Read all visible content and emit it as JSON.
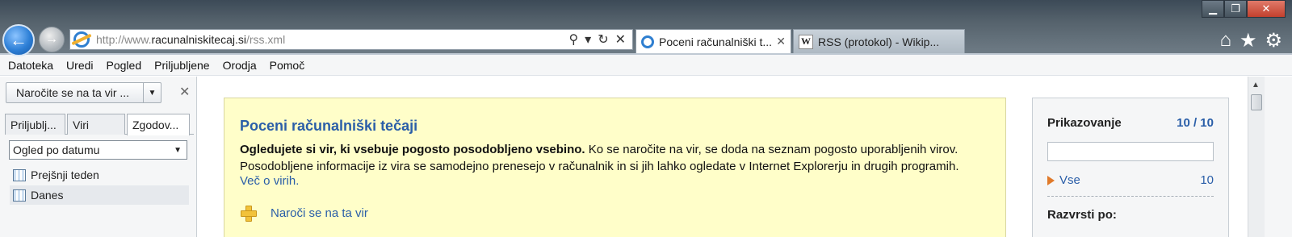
{
  "window_controls": {
    "minimize": "▁",
    "maximize": "❐",
    "close": "✕"
  },
  "address_bar": {
    "url_prefix": "http://www.",
    "url_domain": "racunalniskitecaj.si",
    "url_path": "/rss.xml",
    "icons": [
      "search-icon",
      "dropdown-icon",
      "refresh-icon",
      "stop-icon"
    ]
  },
  "tabs": [
    {
      "label": "Poceni računalniški t...",
      "active": true,
      "icon": "ie-icon"
    },
    {
      "label": "RSS (protokol) - Wikip...",
      "active": false,
      "icon": "wikipedia-icon"
    }
  ],
  "toolbar_icons": [
    "home-icon",
    "favorites-star-icon",
    "tools-gear-icon"
  ],
  "menu": [
    "Datoteka",
    "Uredi",
    "Pogled",
    "Priljubljene",
    "Orodja",
    "Pomoč"
  ],
  "sidebar": {
    "subscribe_button": "Naročite se na ta vir ...",
    "tabs": [
      "Priljublj...",
      "Viri",
      "Zgodov..."
    ],
    "active_tab": "Zgodov...",
    "view_select": "Ogled po datumu",
    "history_items": [
      "Prejšnji teden",
      "Danes"
    ],
    "selected_item": "Danes"
  },
  "feed": {
    "title": "Poceni računalniški tečaji",
    "desc_bold": "Ogledujete si vir, ki vsebuje pogosto posodobljeno vsebino.",
    "desc_rest": " Ko se naročite na vir, se doda na seznam pogosto uporabljenih virov. Posodobljene informacije iz vira se samodejno prenesejo v računalnik in si jih lahko ogledate v Internet Explorerju in drugih programih.",
    "more_link": "Več o virih.",
    "subscribe_link": "Naroči se na ta vir"
  },
  "right_panel": {
    "title": "Prikazovanje",
    "count": "10 / 10",
    "all_label": "Vse",
    "all_count": "10",
    "sort_label": "Razvrsti po:"
  }
}
